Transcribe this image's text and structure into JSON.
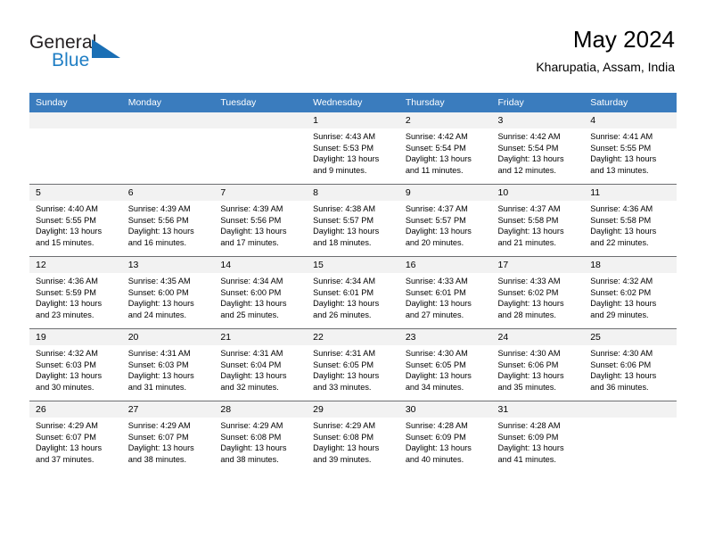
{
  "branding": {
    "name_top": "General",
    "name_bottom": "Blue",
    "accent_color": "#1a6fb5"
  },
  "header": {
    "title": "May 2024",
    "subtitle": "Kharupatia, Assam, India"
  },
  "calendar": {
    "header_bg": "#3a7cbe",
    "daynum_bg": "#f2f2f2",
    "weekdays": [
      "Sunday",
      "Monday",
      "Tuesday",
      "Wednesday",
      "Thursday",
      "Friday",
      "Saturday"
    ],
    "weeks": [
      [
        {
          "day": "",
          "empty": true,
          "sunrise": "",
          "sunset": "",
          "daylight_1": "",
          "daylight_2": ""
        },
        {
          "day": "",
          "empty": true,
          "sunrise": "",
          "sunset": "",
          "daylight_1": "",
          "daylight_2": ""
        },
        {
          "day": "",
          "empty": true,
          "sunrise": "",
          "sunset": "",
          "daylight_1": "",
          "daylight_2": ""
        },
        {
          "day": "1",
          "empty": false,
          "sunrise": "Sunrise: 4:43 AM",
          "sunset": "Sunset: 5:53 PM",
          "daylight_1": "Daylight: 13 hours",
          "daylight_2": "and 9 minutes."
        },
        {
          "day": "2",
          "empty": false,
          "sunrise": "Sunrise: 4:42 AM",
          "sunset": "Sunset: 5:54 PM",
          "daylight_1": "Daylight: 13 hours",
          "daylight_2": "and 11 minutes."
        },
        {
          "day": "3",
          "empty": false,
          "sunrise": "Sunrise: 4:42 AM",
          "sunset": "Sunset: 5:54 PM",
          "daylight_1": "Daylight: 13 hours",
          "daylight_2": "and 12 minutes."
        },
        {
          "day": "4",
          "empty": false,
          "sunrise": "Sunrise: 4:41 AM",
          "sunset": "Sunset: 5:55 PM",
          "daylight_1": "Daylight: 13 hours",
          "daylight_2": "and 13 minutes."
        }
      ],
      [
        {
          "day": "5",
          "empty": false,
          "sunrise": "Sunrise: 4:40 AM",
          "sunset": "Sunset: 5:55 PM",
          "daylight_1": "Daylight: 13 hours",
          "daylight_2": "and 15 minutes."
        },
        {
          "day": "6",
          "empty": false,
          "sunrise": "Sunrise: 4:39 AM",
          "sunset": "Sunset: 5:56 PM",
          "daylight_1": "Daylight: 13 hours",
          "daylight_2": "and 16 minutes."
        },
        {
          "day": "7",
          "empty": false,
          "sunrise": "Sunrise: 4:39 AM",
          "sunset": "Sunset: 5:56 PM",
          "daylight_1": "Daylight: 13 hours",
          "daylight_2": "and 17 minutes."
        },
        {
          "day": "8",
          "empty": false,
          "sunrise": "Sunrise: 4:38 AM",
          "sunset": "Sunset: 5:57 PM",
          "daylight_1": "Daylight: 13 hours",
          "daylight_2": "and 18 minutes."
        },
        {
          "day": "9",
          "empty": false,
          "sunrise": "Sunrise: 4:37 AM",
          "sunset": "Sunset: 5:57 PM",
          "daylight_1": "Daylight: 13 hours",
          "daylight_2": "and 20 minutes."
        },
        {
          "day": "10",
          "empty": false,
          "sunrise": "Sunrise: 4:37 AM",
          "sunset": "Sunset: 5:58 PM",
          "daylight_1": "Daylight: 13 hours",
          "daylight_2": "and 21 minutes."
        },
        {
          "day": "11",
          "empty": false,
          "sunrise": "Sunrise: 4:36 AM",
          "sunset": "Sunset: 5:58 PM",
          "daylight_1": "Daylight: 13 hours",
          "daylight_2": "and 22 minutes."
        }
      ],
      [
        {
          "day": "12",
          "empty": false,
          "sunrise": "Sunrise: 4:36 AM",
          "sunset": "Sunset: 5:59 PM",
          "daylight_1": "Daylight: 13 hours",
          "daylight_2": "and 23 minutes."
        },
        {
          "day": "13",
          "empty": false,
          "sunrise": "Sunrise: 4:35 AM",
          "sunset": "Sunset: 6:00 PM",
          "daylight_1": "Daylight: 13 hours",
          "daylight_2": "and 24 minutes."
        },
        {
          "day": "14",
          "empty": false,
          "sunrise": "Sunrise: 4:34 AM",
          "sunset": "Sunset: 6:00 PM",
          "daylight_1": "Daylight: 13 hours",
          "daylight_2": "and 25 minutes."
        },
        {
          "day": "15",
          "empty": false,
          "sunrise": "Sunrise: 4:34 AM",
          "sunset": "Sunset: 6:01 PM",
          "daylight_1": "Daylight: 13 hours",
          "daylight_2": "and 26 minutes."
        },
        {
          "day": "16",
          "empty": false,
          "sunrise": "Sunrise: 4:33 AM",
          "sunset": "Sunset: 6:01 PM",
          "daylight_1": "Daylight: 13 hours",
          "daylight_2": "and 27 minutes."
        },
        {
          "day": "17",
          "empty": false,
          "sunrise": "Sunrise: 4:33 AM",
          "sunset": "Sunset: 6:02 PM",
          "daylight_1": "Daylight: 13 hours",
          "daylight_2": "and 28 minutes."
        },
        {
          "day": "18",
          "empty": false,
          "sunrise": "Sunrise: 4:32 AM",
          "sunset": "Sunset: 6:02 PM",
          "daylight_1": "Daylight: 13 hours",
          "daylight_2": "and 29 minutes."
        }
      ],
      [
        {
          "day": "19",
          "empty": false,
          "sunrise": "Sunrise: 4:32 AM",
          "sunset": "Sunset: 6:03 PM",
          "daylight_1": "Daylight: 13 hours",
          "daylight_2": "and 30 minutes."
        },
        {
          "day": "20",
          "empty": false,
          "sunrise": "Sunrise: 4:31 AM",
          "sunset": "Sunset: 6:03 PM",
          "daylight_1": "Daylight: 13 hours",
          "daylight_2": "and 31 minutes."
        },
        {
          "day": "21",
          "empty": false,
          "sunrise": "Sunrise: 4:31 AM",
          "sunset": "Sunset: 6:04 PM",
          "daylight_1": "Daylight: 13 hours",
          "daylight_2": "and 32 minutes."
        },
        {
          "day": "22",
          "empty": false,
          "sunrise": "Sunrise: 4:31 AM",
          "sunset": "Sunset: 6:05 PM",
          "daylight_1": "Daylight: 13 hours",
          "daylight_2": "and 33 minutes."
        },
        {
          "day": "23",
          "empty": false,
          "sunrise": "Sunrise: 4:30 AM",
          "sunset": "Sunset: 6:05 PM",
          "daylight_1": "Daylight: 13 hours",
          "daylight_2": "and 34 minutes."
        },
        {
          "day": "24",
          "empty": false,
          "sunrise": "Sunrise: 4:30 AM",
          "sunset": "Sunset: 6:06 PM",
          "daylight_1": "Daylight: 13 hours",
          "daylight_2": "and 35 minutes."
        },
        {
          "day": "25",
          "empty": false,
          "sunrise": "Sunrise: 4:30 AM",
          "sunset": "Sunset: 6:06 PM",
          "daylight_1": "Daylight: 13 hours",
          "daylight_2": "and 36 minutes."
        }
      ],
      [
        {
          "day": "26",
          "empty": false,
          "sunrise": "Sunrise: 4:29 AM",
          "sunset": "Sunset: 6:07 PM",
          "daylight_1": "Daylight: 13 hours",
          "daylight_2": "and 37 minutes."
        },
        {
          "day": "27",
          "empty": false,
          "sunrise": "Sunrise: 4:29 AM",
          "sunset": "Sunset: 6:07 PM",
          "daylight_1": "Daylight: 13 hours",
          "daylight_2": "and 38 minutes."
        },
        {
          "day": "28",
          "empty": false,
          "sunrise": "Sunrise: 4:29 AM",
          "sunset": "Sunset: 6:08 PM",
          "daylight_1": "Daylight: 13 hours",
          "daylight_2": "and 38 minutes."
        },
        {
          "day": "29",
          "empty": false,
          "sunrise": "Sunrise: 4:29 AM",
          "sunset": "Sunset: 6:08 PM",
          "daylight_1": "Daylight: 13 hours",
          "daylight_2": "and 39 minutes."
        },
        {
          "day": "30",
          "empty": false,
          "sunrise": "Sunrise: 4:28 AM",
          "sunset": "Sunset: 6:09 PM",
          "daylight_1": "Daylight: 13 hours",
          "daylight_2": "and 40 minutes."
        },
        {
          "day": "31",
          "empty": false,
          "sunrise": "Sunrise: 4:28 AM",
          "sunset": "Sunset: 6:09 PM",
          "daylight_1": "Daylight: 13 hours",
          "daylight_2": "and 41 minutes."
        },
        {
          "day": "",
          "empty": true,
          "sunrise": "",
          "sunset": "",
          "daylight_1": "",
          "daylight_2": ""
        }
      ]
    ]
  }
}
